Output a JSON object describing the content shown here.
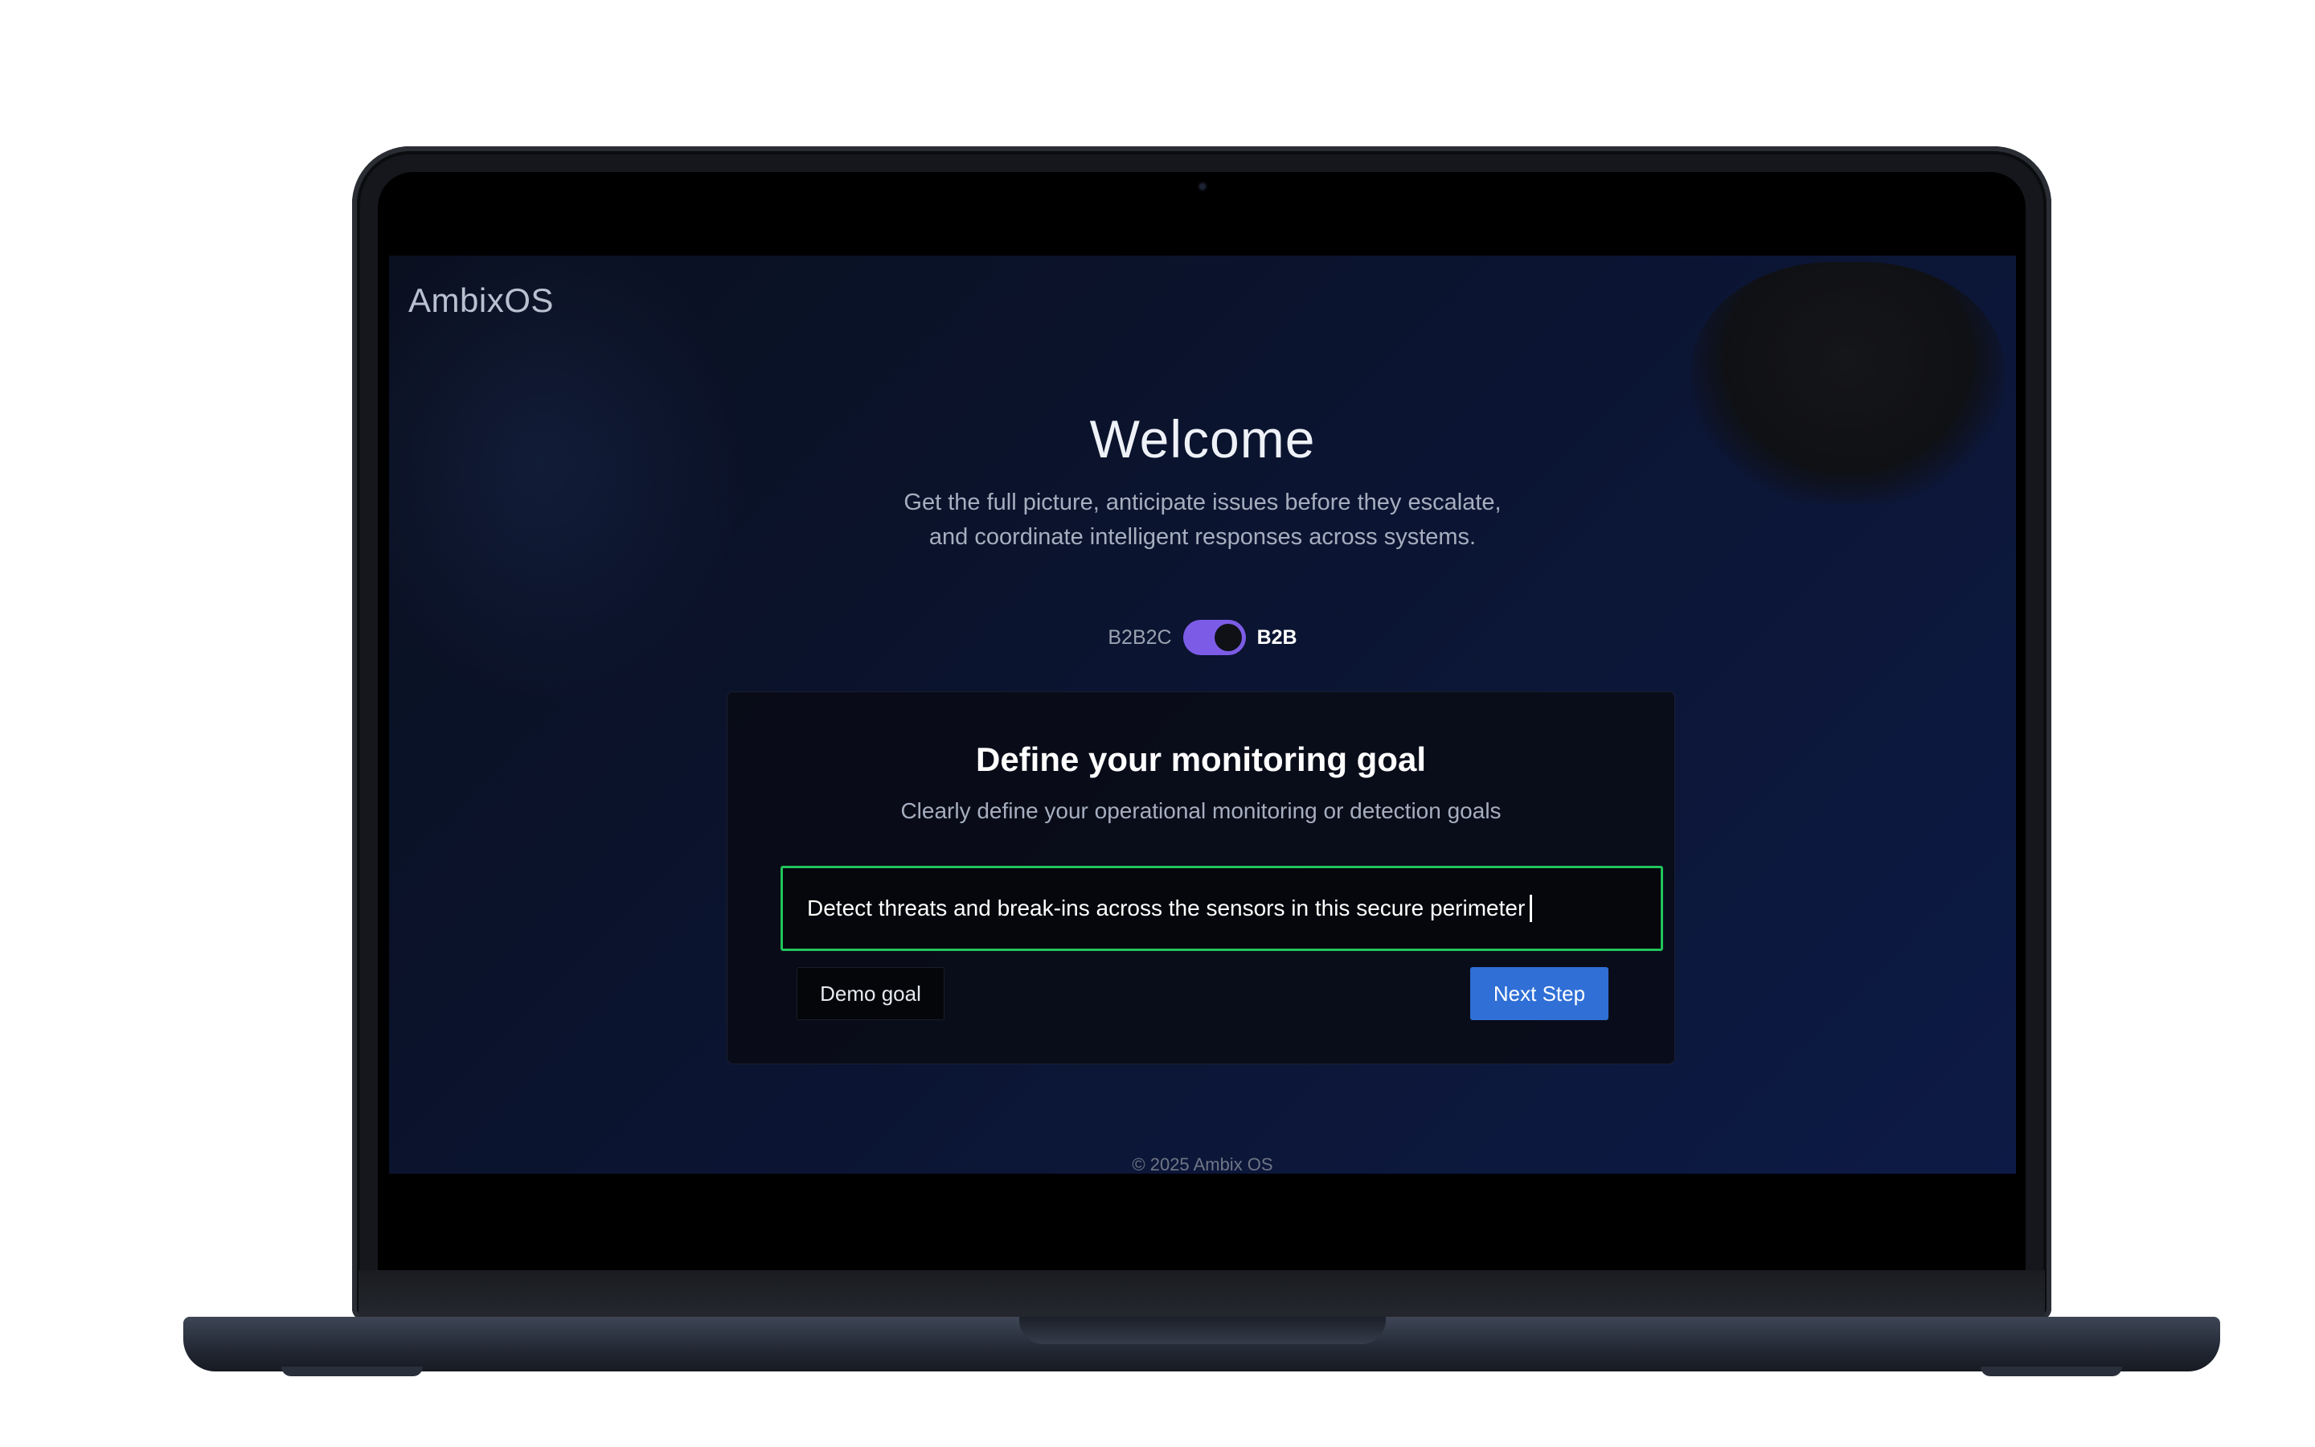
{
  "app": {
    "brand": "AmbixOS",
    "welcome_title": "Welcome",
    "subtitle_line1": "Get the full picture, anticipate issues before they escalate,",
    "subtitle_line2": "and coordinate intelligent responses across systems."
  },
  "toggle": {
    "left_label": "B2B2C",
    "right_label": "B2B",
    "selected": "B2B",
    "accent": "#7c5ce6"
  },
  "goal_card": {
    "title": "Define your monitoring goal",
    "description": "Clearly define your operational monitoring or detection goals",
    "input_value": "Detect threats and break-ins across the sensors in this secure perimeter",
    "input_border": "#21c45b",
    "demo_button": "Demo goal",
    "next_button": "Next Step",
    "next_button_color": "#2f6fd6"
  },
  "footer": {
    "copyright": "© 2025 Ambix OS"
  }
}
